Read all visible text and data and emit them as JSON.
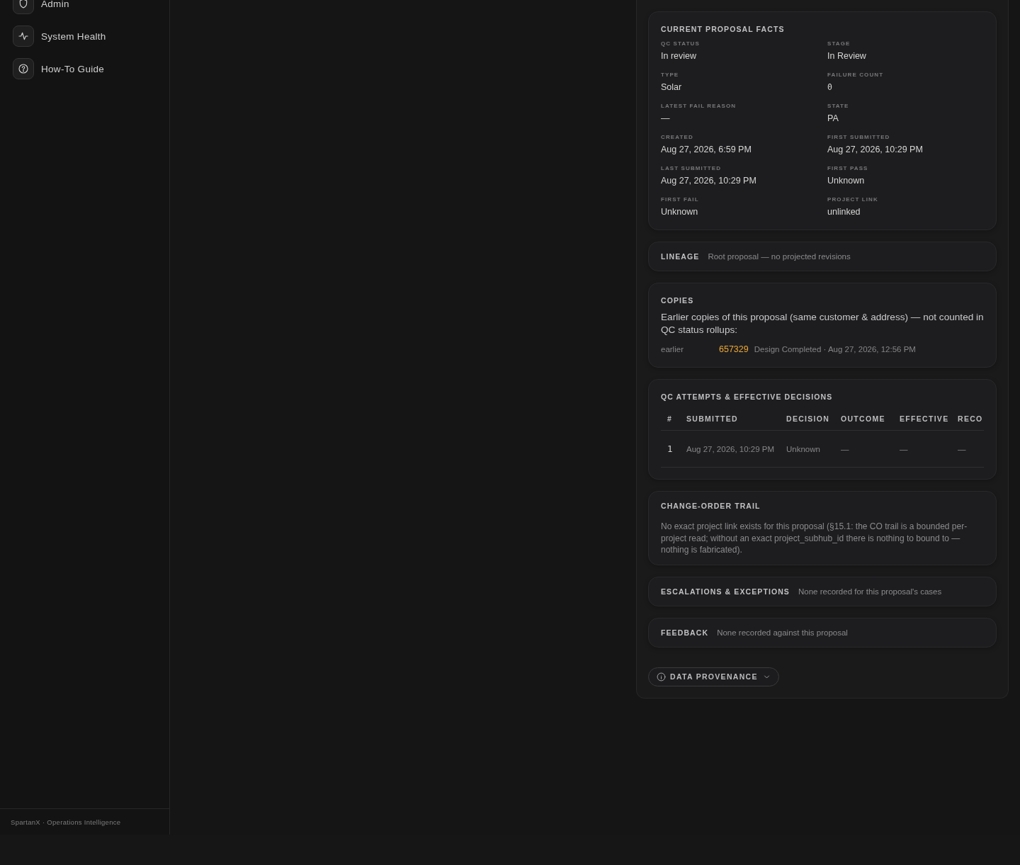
{
  "sidebar": {
    "nav_items": [
      {
        "label": "Admin"
      },
      {
        "label": "System Health"
      },
      {
        "label": "How-To Guide"
      }
    ],
    "footer": "SpartanX · Operations Intelligence"
  },
  "facts": {
    "title": "CURRENT PROPOSAL FACTS",
    "fields": [
      {
        "label": "QC STATUS",
        "value": "In review",
        "kind": "text"
      },
      {
        "label": "STAGE",
        "value": "In Review",
        "kind": "text"
      },
      {
        "label": "TYPE",
        "value": "Solar",
        "kind": "text"
      },
      {
        "label": "FAILURE COUNT",
        "value": "0",
        "kind": "count"
      },
      {
        "label": "LATEST FAIL REASON",
        "value": "—",
        "kind": "text"
      },
      {
        "label": "STATE",
        "value": "PA",
        "kind": "text"
      },
      {
        "label": "CREATED",
        "value": "Aug 27, 2026, 6:59 PM",
        "kind": "text"
      },
      {
        "label": "FIRST SUBMITTED",
        "value": "Aug 27, 2026, 10:29 PM",
        "kind": "text"
      },
      {
        "label": "LAST SUBMITTED",
        "value": "Aug 27, 2026, 10:29 PM",
        "kind": "text"
      },
      {
        "label": "FIRST PASS",
        "value": "Unknown",
        "kind": "text"
      },
      {
        "label": "FIRST FAIL",
        "value": "Unknown",
        "kind": "text"
      },
      {
        "label": "PROJECT LINK",
        "value": "unlinked",
        "kind": "text"
      }
    ]
  },
  "lineage": {
    "title": "LINEAGE",
    "text": "Root proposal — no projected revisions"
  },
  "copies": {
    "title": "COPIES",
    "description": "Earlier copies of this proposal (same customer & address) — not counted in QC status rollups:",
    "items": [
      {
        "relation": "earlier",
        "proposal_id": "657329",
        "details": "Design Completed · Aug 27, 2026, 12:56 PM"
      }
    ]
  },
  "qc_attempts": {
    "title": "QC ATTEMPTS & EFFECTIVE DECISIONS",
    "columns": [
      "#",
      "SUBMITTED",
      "DECISION",
      "OUTCOME",
      "EFFECTIVE",
      "RECO"
    ],
    "rows": [
      [
        "1",
        "Aug 27, 2026, 10:29 PM",
        "Unknown",
        "—",
        "—",
        "—"
      ]
    ]
  },
  "change_order_trail": {
    "title": "CHANGE-ORDER TRAIL",
    "text": "No exact project link exists for this proposal (§15.1: the CO trail is a bounded per-project read; without an exact project_subhub_id there is nothing to bound to — nothing is fabricated)."
  },
  "escalations": {
    "title": "ESCALATIONS & EXCEPTIONS",
    "text": "None recorded for this proposal's cases"
  },
  "feedback": {
    "title": "FEEDBACK",
    "text": "None recorded against this proposal"
  },
  "provenance": {
    "label": "DATA PROVENANCE",
    "expanded": false
  }
}
